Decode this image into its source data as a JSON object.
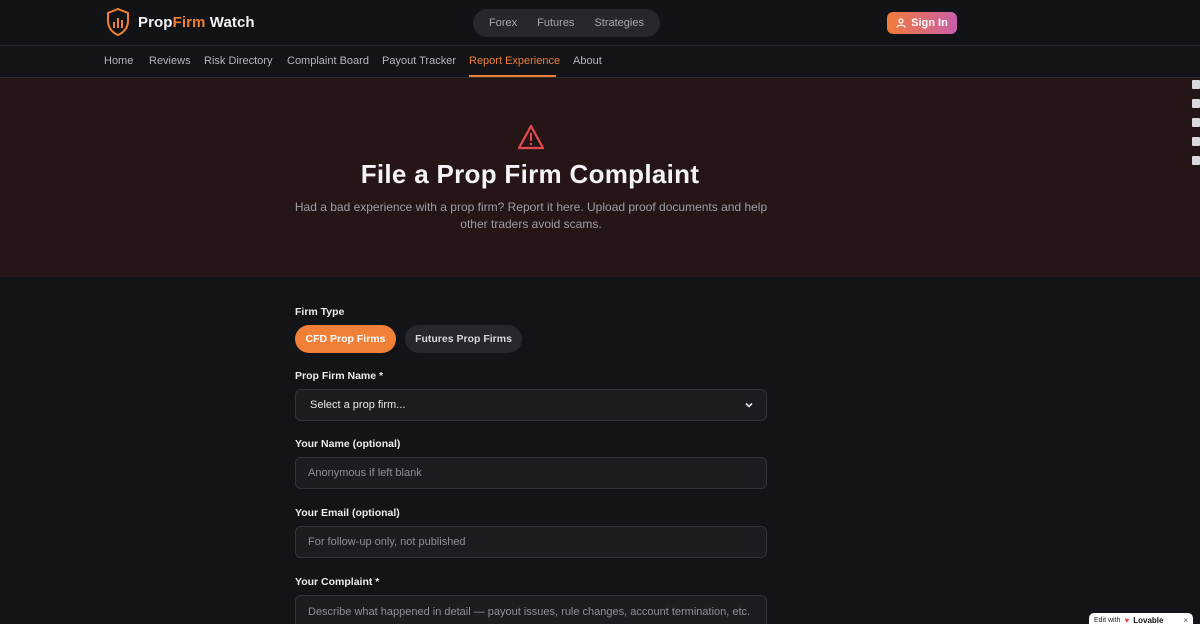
{
  "header": {
    "logo_part1": "Prop",
    "logo_part2": "Firm",
    "logo_part3": " Watch",
    "markets": [
      "Forex",
      "Futures",
      "Strategies"
    ],
    "signin_label": "Sign In"
  },
  "nav": {
    "items": [
      "Home",
      "Reviews",
      "Risk Directory",
      "Complaint Board",
      "Payout Tracker",
      "Report Experience",
      "About"
    ],
    "active": "Report Experience"
  },
  "hero": {
    "icon": "warning-triangle-icon",
    "title": "File a Prop Firm Complaint",
    "subtitle": "Had a bad experience with a prop firm? Report it here. Upload proof documents and help other traders avoid scams."
  },
  "form": {
    "firm_type_label": "Firm Type",
    "firm_types": [
      "CFD Prop Firms",
      "Futures Prop Firms"
    ],
    "firm_type_selected": "CFD Prop Firms",
    "firm_name_label": "Prop Firm Name *",
    "firm_name_value": "Select a prop firm...",
    "name_label": "Your Name (optional)",
    "name_placeholder": "Anonymous if left blank",
    "email_label": "Your Email (optional)",
    "email_placeholder": "For follow-up only, not published",
    "complaint_label": "Your Complaint *",
    "complaint_placeholder": "Describe what happened in detail — payout issues, rule changes, account termination, etc."
  },
  "badge": {
    "edit_with": "Edit with",
    "brand": "Lovable",
    "close": "×"
  },
  "colors": {
    "accent": "#f07f37",
    "hero_bg": "#261517",
    "page_bg": "#131417",
    "warning": "#e5484d"
  }
}
